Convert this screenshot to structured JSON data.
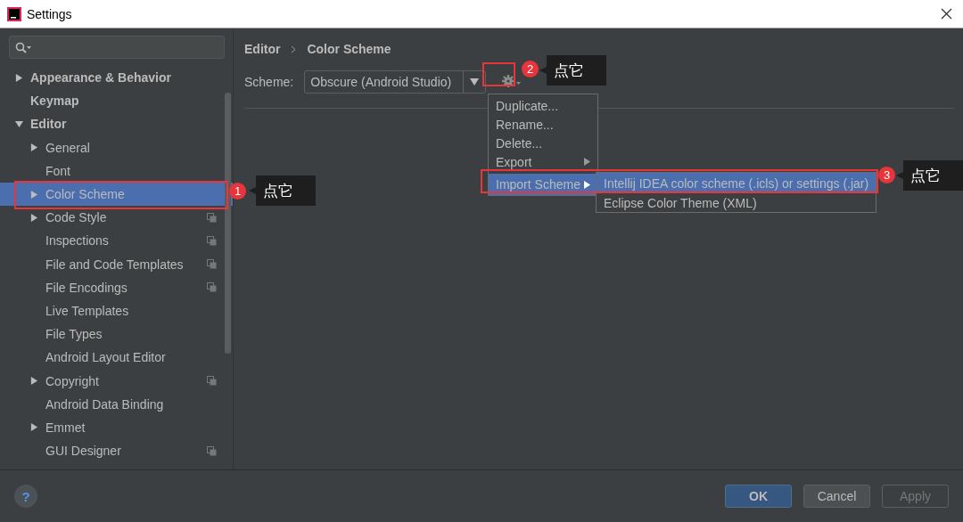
{
  "window": {
    "title": "Settings"
  },
  "tree": [
    {
      "label": "Appearance & Behavior",
      "expandable": true,
      "expanded": false,
      "selected": false,
      "project_level": false
    },
    {
      "label": "Keymap",
      "expandable": false,
      "expanded": false,
      "selected": false,
      "project_level": false
    },
    {
      "label": "Editor",
      "expandable": true,
      "expanded": true,
      "selected": false,
      "project_level": false,
      "children": [
        {
          "label": "General",
          "expandable": true,
          "expanded": false,
          "selected": false,
          "project_level": false
        },
        {
          "label": "Font",
          "expandable": false,
          "expanded": false,
          "selected": false,
          "project_level": false
        },
        {
          "label": "Color Scheme",
          "expandable": true,
          "expanded": false,
          "selected": true,
          "project_level": false
        },
        {
          "label": "Code Style",
          "expandable": true,
          "expanded": false,
          "selected": false,
          "project_level": true
        },
        {
          "label": "Inspections",
          "expandable": false,
          "expanded": false,
          "selected": false,
          "project_level": true
        },
        {
          "label": "File and Code Templates",
          "expandable": false,
          "expanded": false,
          "selected": false,
          "project_level": true
        },
        {
          "label": "File Encodings",
          "expandable": false,
          "expanded": false,
          "selected": false,
          "project_level": true
        },
        {
          "label": "Live Templates",
          "expandable": false,
          "expanded": false,
          "selected": false,
          "project_level": false
        },
        {
          "label": "File Types",
          "expandable": false,
          "expanded": false,
          "selected": false,
          "project_level": false
        },
        {
          "label": "Android Layout Editor",
          "expandable": false,
          "expanded": false,
          "selected": false,
          "project_level": false
        },
        {
          "label": "Copyright",
          "expandable": true,
          "expanded": false,
          "selected": false,
          "project_level": true
        },
        {
          "label": "Android Data Binding",
          "expandable": false,
          "expanded": false,
          "selected": false,
          "project_level": false
        },
        {
          "label": "Emmet",
          "expandable": true,
          "expanded": false,
          "selected": false,
          "project_level": false
        },
        {
          "label": "GUI Designer",
          "expandable": false,
          "expanded": false,
          "selected": false,
          "project_level": true
        }
      ]
    }
  ],
  "breadcrumb": [
    "Editor",
    "Color Scheme"
  ],
  "scheme": {
    "label": "Scheme:",
    "value": "Obscure (Android Studio)"
  },
  "menu": [
    {
      "label": "Duplicate...",
      "has_submenu": false,
      "selected": false
    },
    {
      "label": "Rename...",
      "has_submenu": false,
      "selected": false
    },
    {
      "label": "Delete...",
      "has_submenu": false,
      "selected": false
    },
    {
      "label": "Export",
      "has_submenu": true,
      "selected": false
    },
    {
      "label": "Import Scheme",
      "has_submenu": true,
      "selected": true
    }
  ],
  "submenu": [
    {
      "label": "Intellij IDEA color scheme (.icls) or settings (.jar)",
      "selected": true
    },
    {
      "label": "Eclipse Color Theme (XML)",
      "selected": false
    }
  ],
  "help": "?",
  "buttons": [
    {
      "label": "OK",
      "kind": "primary",
      "disabled": false
    },
    {
      "label": "Cancel",
      "kind": "default",
      "disabled": false
    },
    {
      "label": "Apply",
      "kind": "default",
      "disabled": true
    }
  ],
  "annotations": [
    {
      "number": "1",
      "note": "点它"
    },
    {
      "number": "2",
      "note": "点它"
    },
    {
      "number": "3",
      "note": "点它"
    }
  ]
}
